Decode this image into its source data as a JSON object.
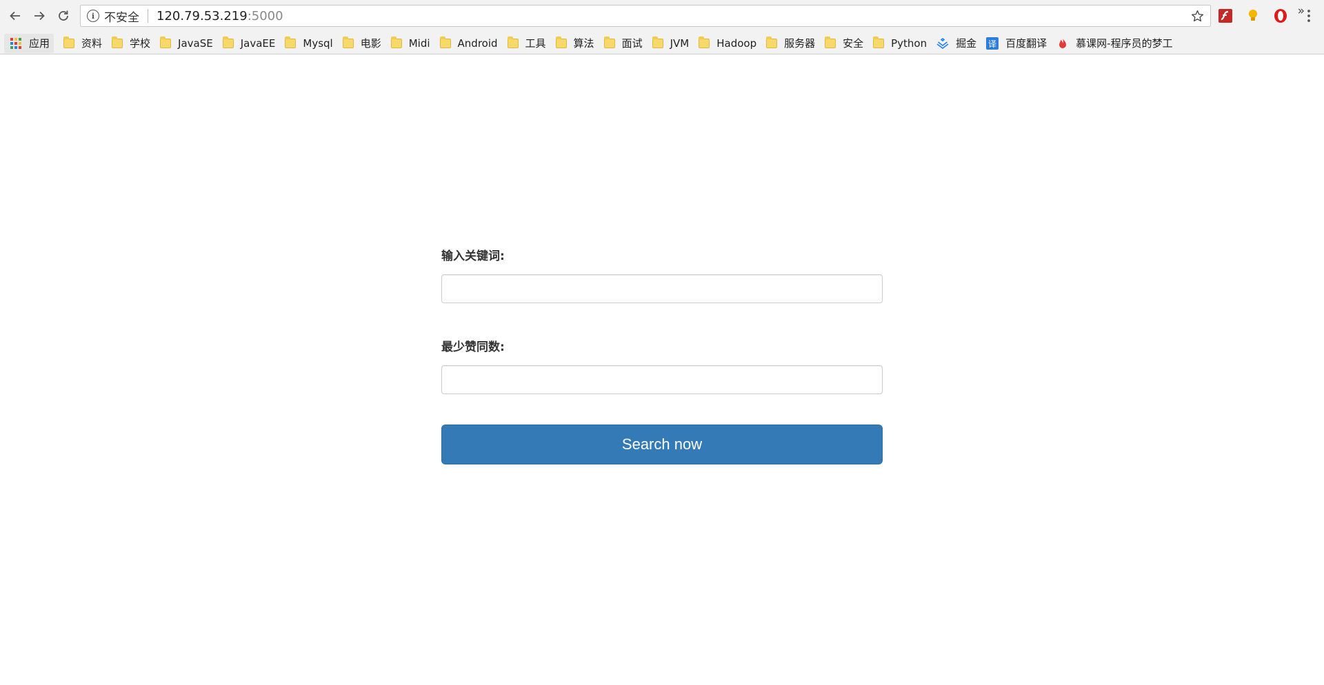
{
  "browser": {
    "address_bar": {
      "security_label": "不安全",
      "url_host": "120.79.53.219",
      "url_port": ":5000"
    },
    "icons": {
      "back": "back-arrow-icon",
      "forward": "forward-arrow-icon",
      "reload": "reload-icon",
      "info": "info-icon",
      "star": "star-icon",
      "menu": "kebab-menu-icon"
    },
    "extensions": [
      "flash-extension-icon",
      "lightbulb-extension-icon",
      "opera-extension-icon"
    ],
    "bookmarks": [
      {
        "label": "应用",
        "icon": "apps-grid-icon"
      },
      {
        "label": "资料",
        "icon": "folder-icon"
      },
      {
        "label": "学校",
        "icon": "folder-icon"
      },
      {
        "label": "JavaSE",
        "icon": "folder-icon"
      },
      {
        "label": "JavaEE",
        "icon": "folder-icon"
      },
      {
        "label": "Mysql",
        "icon": "folder-icon"
      },
      {
        "label": "电影",
        "icon": "folder-icon"
      },
      {
        "label": "Midi",
        "icon": "folder-icon"
      },
      {
        "label": "Android",
        "icon": "folder-icon"
      },
      {
        "label": "工具",
        "icon": "folder-icon"
      },
      {
        "label": "算法",
        "icon": "folder-icon"
      },
      {
        "label": "面试",
        "icon": "folder-icon"
      },
      {
        "label": "JVM",
        "icon": "folder-icon"
      },
      {
        "label": "Hadoop",
        "icon": "folder-icon"
      },
      {
        "label": "服务器",
        "icon": "folder-icon"
      },
      {
        "label": "安全",
        "icon": "folder-icon"
      },
      {
        "label": "Python",
        "icon": "folder-icon"
      },
      {
        "label": "掘金",
        "icon": "juejin-icon"
      },
      {
        "label": "百度翻译",
        "icon": "translate-icon"
      },
      {
        "label": "慕课网-程序员的梦工",
        "icon": "flame-icon"
      }
    ],
    "bookmarks_overflow": "»"
  },
  "form": {
    "keyword_label": "输入关键词:",
    "keyword_value": "",
    "min_votes_label": "最少赞同数:",
    "min_votes_value": "",
    "submit_label": "Search now"
  },
  "colors": {
    "button_bg": "#337ab7",
    "button_border": "#2e6da4"
  }
}
